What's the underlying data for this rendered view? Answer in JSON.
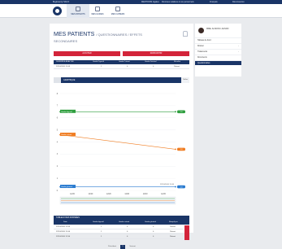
{
  "topbar": {
    "left_text": "Bugbounty HALIO",
    "links": [
      "MENTIONS légales",
      "Données relatives à vos personnels",
      "Français",
      "Déconnexion"
    ]
  },
  "nav": [
    {
      "label": "MES PATIENTS",
      "icon": "users-icon",
      "active": true
    },
    {
      "label": "MES GUIDES",
      "icon": "guide-icon",
      "active": false
    },
    {
      "label": "MES CAHIERS",
      "icon": "notebook-icon",
      "active": false
    }
  ],
  "page": {
    "title": "MES PATIENTS",
    "title_suffix": "/ QUESTIONNAIRES / EFFETS",
    "subtitle": "SECONDAIRES",
    "add_label": "AJOUTER",
    "refresh_label": "RAFRAICHIR"
  },
  "summary_table": {
    "headers": [
      "DERNIÈRE ANALYSE",
      "Grade Digestif",
      "Grade Cutané",
      "Grade Général",
      "Résultat"
    ],
    "rows": [
      [
        "22/10/2020 12:45",
        "1",
        "0",
        "0",
        "Patient"
      ]
    ]
  },
  "tabs": {
    "left": "",
    "active": "GRAPHIQUE",
    "right": "Tables"
  },
  "chart_data": {
    "type": "line",
    "title": "",
    "ylim": [
      0,
      8
    ],
    "y_ticks": [
      "8",
      "7",
      "6",
      "5",
      "4",
      "3",
      "2",
      "1",
      "0"
    ],
    "x_ticks": [
      "12/20",
      "12/20",
      "12/20",
      "12/20",
      "12/20",
      "12/20"
    ],
    "series": [
      {
        "name": "Grade digestif",
        "color": "#2e9e3e",
        "values": [
          6.5,
          6.5
        ]
      },
      {
        "name": "Grade cutané",
        "color": "#f07d22",
        "values": [
          4.6,
          3.4
        ]
      },
      {
        "name": "Grade général",
        "color": "#2a7bd0",
        "values": [
          0.3,
          0.3
        ]
      }
    ],
    "end_labels": [
      "1.0",
      "1.0",
      "1.0"
    ],
    "annotation": "22/10/2020 12:45"
  },
  "data_table": {
    "section_title": "TABLEAU DES DONNÉES",
    "headers": [
      "Date",
      "Grade digestif",
      "Grade cutané",
      "Grade général",
      "Rempli par"
    ],
    "rows": [
      [
        "22/10/2020 12:45",
        "1",
        "0",
        "0",
        "Patient"
      ],
      [
        "22/10/2020 12:40",
        "1",
        "0",
        "0",
        "Patient"
      ],
      [
        "22/10/2020 12:30",
        "1",
        "0",
        "0",
        "Patient"
      ]
    ]
  },
  "pagination": {
    "prev": "Précédent",
    "current": "1",
    "next": "Suivant"
  },
  "sidebar": {
    "user_name": "MME. ALISON F. ALISON",
    "items": [
      {
        "label": "Tableau de bord",
        "active": false
      },
      {
        "label": "Dossier",
        "active": false
      },
      {
        "label": "Traitements",
        "active": false
      },
      {
        "label": "Documents",
        "active": false
      },
      {
        "label": "Questionnaires",
        "active": true
      }
    ]
  },
  "colors": {
    "brand": "#1a3567",
    "danger": "#d3243a"
  }
}
